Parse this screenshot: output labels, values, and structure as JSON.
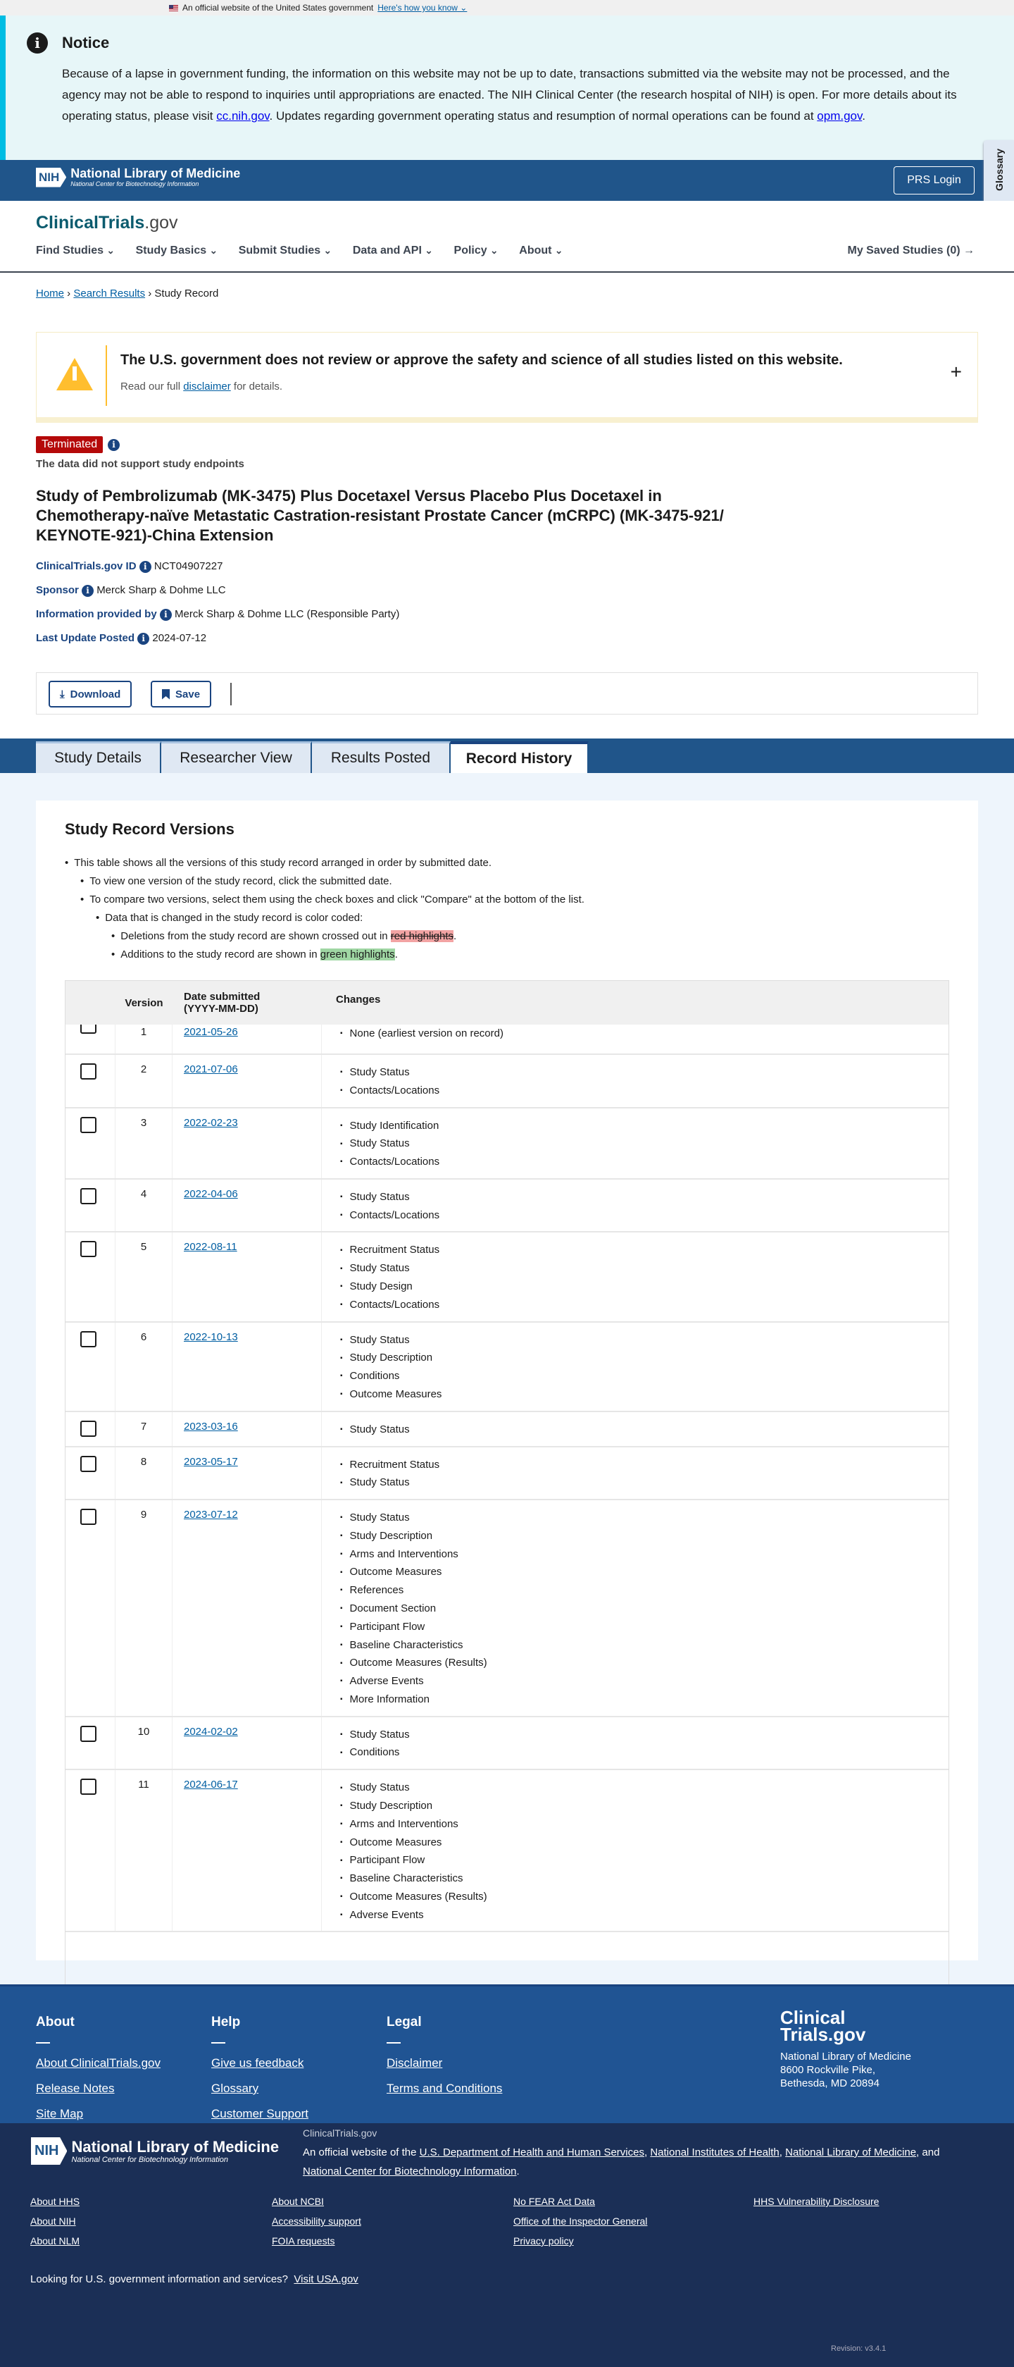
{
  "gov_banner": {
    "text": "An official website of the United States government",
    "link": "Here's how you know"
  },
  "notice": {
    "title": "Notice",
    "text_1": "Because of a lapse in government funding, the information on this website may not be up to date, transactions submitted via the website may not be processed, and the agency may not be able to respond to inquiries until appropriations are enacted. The NIH Clinical Center (the research hospital of NIH) is open. For more details about its operating status, please visit ",
    "link_1": "cc.nih.gov",
    "text_2": ". Updates regarding government operating status and resumption of normal operations can be found at ",
    "link_2": "opm.gov",
    "text_3": "."
  },
  "nih": {
    "badge": "NIH",
    "title": "National Library of Medicine",
    "subtitle": "National Center for Biotechnology Information",
    "prs_login": "PRS Login"
  },
  "glossary": "Glossary",
  "site": {
    "logo_main": "ClinicalTrials",
    "logo_suffix": ".gov"
  },
  "nav": {
    "items": [
      "Find Studies",
      "Study Basics",
      "Submit Studies",
      "Data and API",
      "Policy",
      "About"
    ],
    "saved": "My Saved Studies (0)"
  },
  "breadcrumb": {
    "home": "Home",
    "search": "Search Results",
    "current": "Study Record"
  },
  "disclaimer": {
    "title": "The U.S. government does not review or approve the safety and science of all studies listed on this website.",
    "pre": "Read our full ",
    "link": "disclaimer",
    "post": " for details."
  },
  "study": {
    "status": "Terminated",
    "reason": "The data did not support study endpoints",
    "title": "Study of Pembrolizumab (MK-3475) Plus Docetaxel Versus Placebo Plus Docetaxel in Chemotherapy-naïve Metastatic Castration-resistant Prostate Cancer (mCRPC) (MK-3475-921/ KEYNOTE-921)-China Extension",
    "id_label": "ClinicalTrials.gov ID",
    "id": "NCT04907227",
    "sponsor_label": "Sponsor",
    "sponsor": "Merck Sharp & Dohme LLC",
    "provided_label": "Information provided by",
    "provided": "Merck Sharp & Dohme LLC (Responsible Party)",
    "updated_label": "Last Update Posted",
    "updated": "2024-07-12"
  },
  "actions": {
    "download": "Download",
    "save": "Save"
  },
  "tabs": [
    "Study Details",
    "Researcher View",
    "Results Posted",
    "Record History"
  ],
  "versions": {
    "title": "Study Record Versions",
    "b1": "This table shows all the versions of this study record arranged in order by submitted date.",
    "b2": "To view one version of the study record, click the submitted date.",
    "b3": "To compare two versions, select them using the check boxes and click \"Compare\" at the bottom of the list.",
    "b4": "Data that is changed in the study record is color coded:",
    "b5_pre": "Deletions from the study record are shown crossed out in ",
    "b5_hl": "red highlights",
    "b6_pre": "Additions to the study record are shown in ",
    "b6_hl": "green highlights",
    "dot": ".",
    "headers": {
      "version": "Version",
      "date": "Date submitted",
      "date_fmt": "(YYYY-MM-DD)",
      "changes": "Changes"
    },
    "rows": [
      {
        "version": "1",
        "date": "2021-05-26",
        "changes": [
          "None (earliest version on record)"
        ]
      },
      {
        "version": "2",
        "date": "2021-07-06",
        "changes": [
          "Study Status",
          "Contacts/Locations"
        ]
      },
      {
        "version": "3",
        "date": "2022-02-23",
        "changes": [
          "Study Identification",
          "Study Status",
          "Contacts/Locations"
        ]
      },
      {
        "version": "4",
        "date": "2022-04-06",
        "changes": [
          "Study Status",
          "Contacts/Locations"
        ]
      },
      {
        "version": "5",
        "date": "2022-08-11",
        "changes": [
          "Recruitment Status",
          "Study Status",
          "Study Design",
          "Contacts/Locations"
        ]
      },
      {
        "version": "6",
        "date": "2022-10-13",
        "changes": [
          "Study Status",
          "Study Description",
          "Conditions",
          "Outcome Measures"
        ]
      },
      {
        "version": "7",
        "date": "2023-03-16",
        "changes": [
          "Study Status"
        ]
      },
      {
        "version": "8",
        "date": "2023-05-17",
        "changes": [
          "Recruitment Status",
          "Study Status"
        ]
      },
      {
        "version": "9",
        "date": "2023-07-12",
        "changes": [
          "Study Status",
          "Study Description",
          "Arms and Interventions",
          "Outcome Measures",
          "References",
          "Document Section",
          "Participant Flow",
          "Baseline Characteristics",
          "Outcome Measures (Results)",
          "Adverse Events",
          "More Information"
        ]
      },
      {
        "version": "10",
        "date": "2024-02-02",
        "changes": [
          "Study Status",
          "Conditions"
        ]
      },
      {
        "version": "11",
        "date": "2024-06-17",
        "changes": [
          "Study Status",
          "Study Description",
          "Arms and Interventions",
          "Outcome Measures",
          "Participant Flow",
          "Baseline Characteristics",
          "Outcome Measures (Results)",
          "Adverse Events"
        ]
      }
    ]
  },
  "footer": {
    "cols": [
      {
        "title": "About",
        "links": [
          "About ClinicalTrials.gov",
          "Release Notes",
          "Site Map"
        ]
      },
      {
        "title": "Help",
        "links": [
          "Give us feedback",
          "Glossary",
          "Customer Support"
        ]
      },
      {
        "title": "Legal",
        "links": [
          "Disclaimer",
          "Terms and Conditions"
        ]
      }
    ],
    "logo_1": "Clinical",
    "logo_2": "Trials.gov",
    "addr_1": "National Library of Medicine",
    "addr_2": "8600 Rockville Pike, Bethesda, MD 20894",
    "site": "ClinicalTrials.gov",
    "official_pre": "An official website of the ",
    "hhs": "U.S. Department of Health and Human Services",
    "nih": "National Institutes of Health",
    "nlm": "National Library of Medicine",
    "and": ", and ",
    "ncbi": "National Center for Biotechnology Information",
    "comma": ", ",
    "bottom_links": [
      [
        "About HHS",
        "About NIH",
        "About NLM"
      ],
      [
        "About NCBI",
        "Accessibility support",
        "FOIA requests"
      ],
      [
        "No FEAR Act Data",
        "Office of the Inspector General",
        "Privacy policy"
      ],
      [
        "HHS Vulnerability Disclosure"
      ]
    ],
    "usa_q": "Looking for U.S. government information and services?",
    "usa_link": "Visit USA.gov",
    "revision": "Revision: v3.4.1"
  }
}
